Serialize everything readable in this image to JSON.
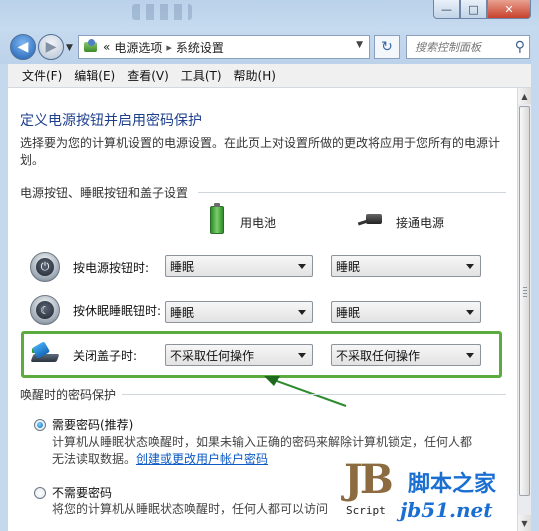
{
  "window": {
    "minimize_glyph": "—",
    "maximize_glyph": "□",
    "close_glyph": "✕"
  },
  "address_bar": {
    "overflow": "«",
    "crumbs": [
      "电源选项",
      "系统设置"
    ],
    "separator": "▸",
    "search_placeholder": "搜索控制面板"
  },
  "menu": [
    "文件(F)",
    "编辑(E)",
    "查看(V)",
    "工具(T)",
    "帮助(H)"
  ],
  "page": {
    "title": "定义电源按钮并启用密码保护",
    "description": "选择要为您的计算机设置的电源设置。在此页上对设置所做的更改将应用于您所有的电源计划。",
    "section_buttons": "电源按钮、睡眠按钮和盖子设置",
    "col_battery": "用电池",
    "col_plugged": "接通电源",
    "rows": [
      {
        "label": "按电源按钮时:",
        "battery": "睡眠",
        "plugged": "睡眠"
      },
      {
        "label": "按休眠睡眠钮时:",
        "battery": "睡眠",
        "plugged": "睡眠"
      },
      {
        "label": "关闭盖子时:",
        "battery": "不采取任何操作",
        "plugged": "不采取任何操作"
      }
    ],
    "section_password": "唤醒时的密码保护",
    "opt_require": "需要密码(推荐)",
    "opt_require_desc_1": "计算机从睡眠状态唤醒时，如果未输入正确的密码来解除计算机锁定，任何人都",
    "opt_require_desc_2": "无法读取数据。",
    "opt_require_link": "创建或更改用户帐户密码",
    "opt_norequire": "不需要密码",
    "opt_norequire_desc": "将您的计算机从睡眠状态唤醒时，任何人都可以访问"
  },
  "watermark": {
    "logo": "JB",
    "script_label": "Script",
    "site_name": "脚本之家",
    "url": "jb51.net"
  },
  "colors": {
    "highlight_box": "#5cab3f",
    "heading": "#1d3f8c",
    "link": "#0b59c4"
  }
}
